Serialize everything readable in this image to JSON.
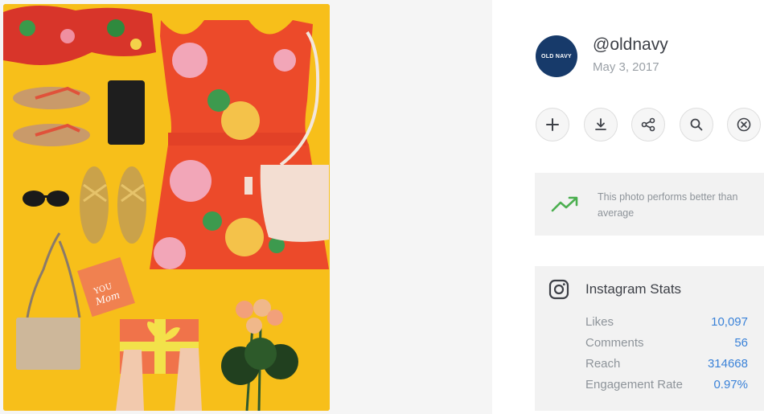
{
  "profile": {
    "avatar_text": "OLD NAVY",
    "username": "@oldnavy",
    "date": "May 3, 2017"
  },
  "photo": {
    "card_text_1": "YOU",
    "card_text_2": "Mom"
  },
  "actions": [
    {
      "icon": "plus-icon"
    },
    {
      "icon": "download-icon"
    },
    {
      "icon": "share-icon"
    },
    {
      "icon": "search-icon"
    },
    {
      "icon": "close-icon"
    }
  ],
  "performance": {
    "text": "This photo performs better than average",
    "icon": "trending-up-icon",
    "icon_color": "#4caf50"
  },
  "stats": {
    "title": "Instagram Stats",
    "icon": "instagram-icon",
    "value_color": "#3a82d8",
    "rows": [
      {
        "label": "Likes",
        "value": "10,097"
      },
      {
        "label": "Comments",
        "value": "56"
      },
      {
        "label": "Reach",
        "value": "314668"
      },
      {
        "label": "Engagement Rate",
        "value": "0.97%"
      }
    ]
  }
}
